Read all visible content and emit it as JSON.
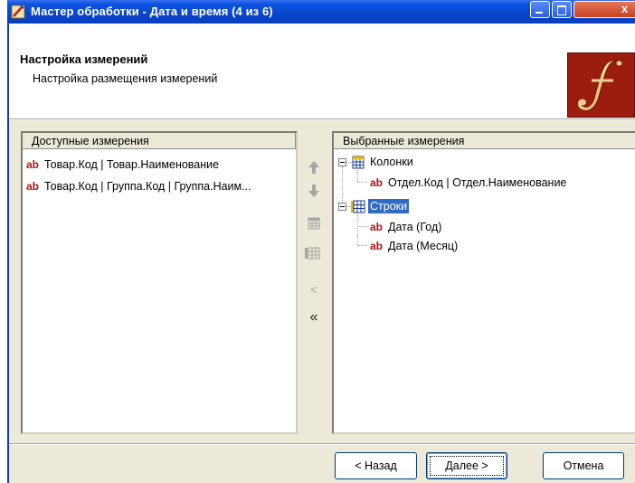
{
  "window": {
    "title": "Мастер обработки - Дата и время (4 из 6)",
    "close_glyph": "x"
  },
  "header": {
    "title": "Настройка измерений",
    "subtitle": "Настройка размещения измерений"
  },
  "available": {
    "column_header": "Доступные измерения",
    "items": [
      {
        "type_badge": "ab",
        "label": "Товар.Код | Товар.Наименование"
      },
      {
        "type_badge": "ab",
        "label": "Товар.Код | Группа.Код | Группа.Наим..."
      }
    ]
  },
  "selected": {
    "column_header": "Выбранные измерения",
    "columns_group": {
      "label": "Колонки",
      "items": [
        {
          "type_badge": "ab",
          "label": "Отдел.Код | Отдел.Наименование"
        }
      ]
    },
    "rows_group": {
      "label": "Строки",
      "items": [
        {
          "type_badge": "ab",
          "label": "Дата (Год)"
        },
        {
          "type_badge": "ab",
          "label": "Дата (Месяц)"
        }
      ]
    }
  },
  "move_buttons": {
    "move_left": "<",
    "move_all_left": "«"
  },
  "footer": {
    "back_label": "< Назад",
    "next_label": "Далее >",
    "cancel_label": "Отмена"
  },
  "colors": {
    "title_bar": "#0a45cc",
    "badge_ab": "#b01010",
    "selection": "#316ac5",
    "logo_bg": "#9c1c0e",
    "dialog_bg": "#ece9d8"
  }
}
